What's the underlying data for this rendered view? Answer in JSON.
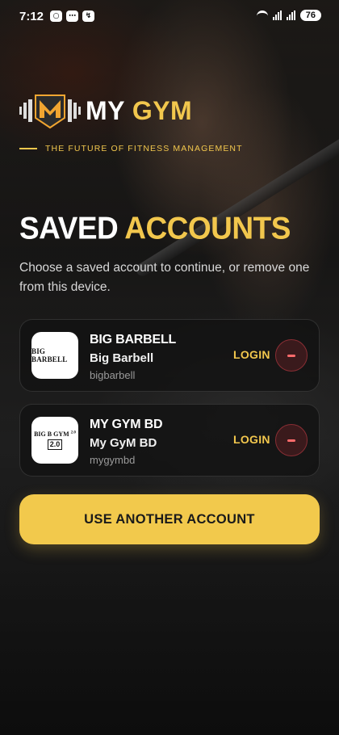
{
  "status_bar": {
    "time": "7:12",
    "battery": "76",
    "left_icons": [
      "voicemail-icon",
      "chat-icon",
      "messenger-icon"
    ]
  },
  "brand": {
    "name_first": "MY",
    "name_second": "GYM",
    "tagline": "THE FUTURE OF FITNESS MANAGEMENT",
    "accent_color": "#f2c74d"
  },
  "page": {
    "title_first": "SAVED",
    "title_second": "ACCOUNTS",
    "subtitle": "Choose a saved account to continue, or remove one from this device."
  },
  "accounts": [
    {
      "name_caps": "BIG BARBELL",
      "name": "Big Barbell",
      "handle": "bigbarbell",
      "avatar_text": "BIG BARBELL",
      "login_label": "LOGIN"
    },
    {
      "name_caps": "MY GYM BD",
      "name": "My GyM BD",
      "handle": "mygymbd",
      "avatar_text": "BIG B GYM",
      "avatar_small": "2.0",
      "avatar_version": "2.0",
      "login_label": "LOGIN"
    }
  ],
  "cta": {
    "label": "USE ANOTHER ACCOUNT"
  }
}
